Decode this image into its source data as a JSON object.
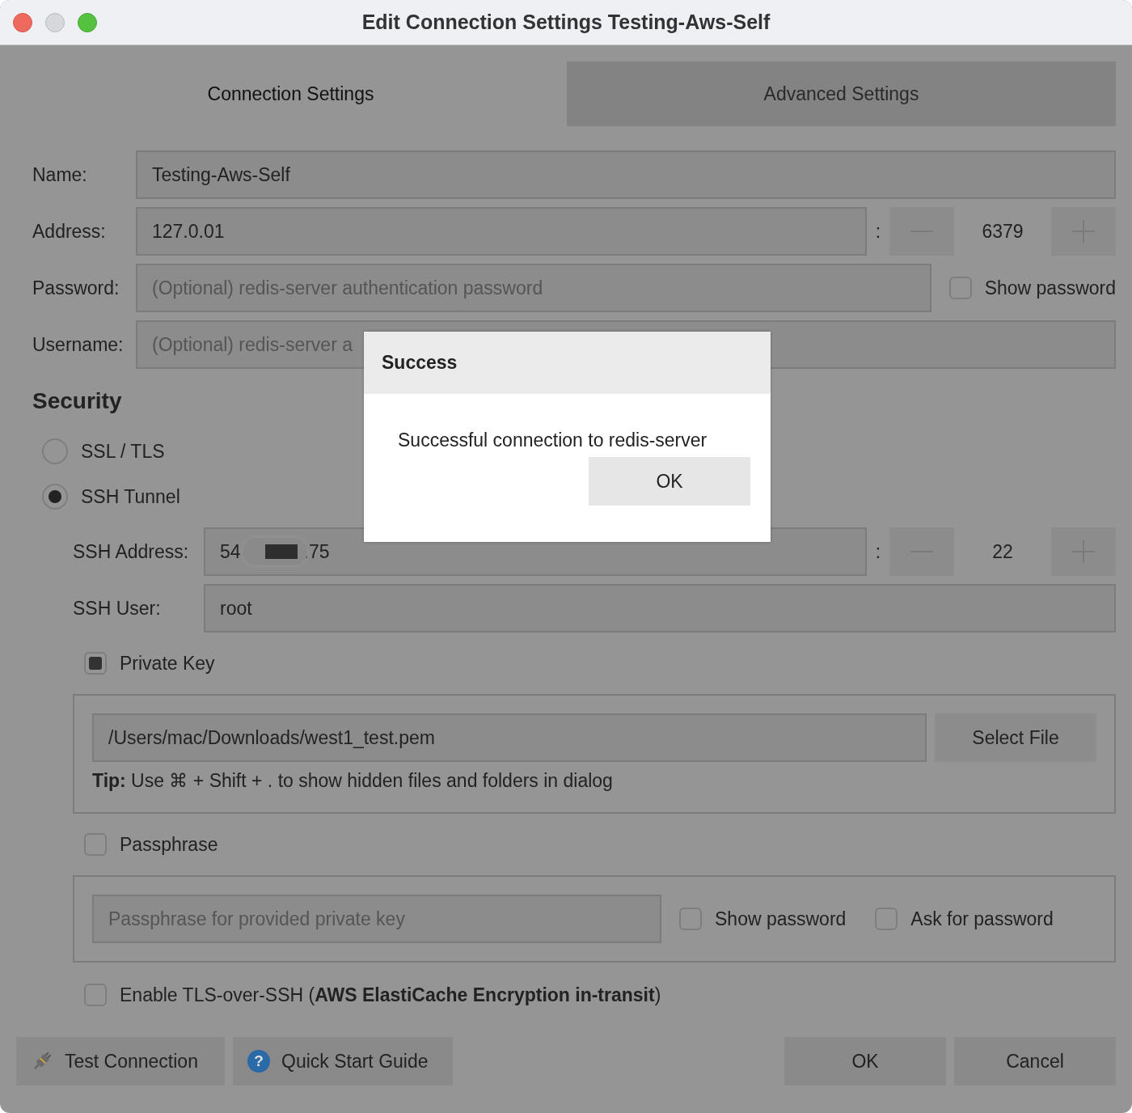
{
  "window": {
    "title": "Edit Connection Settings Testing-Aws-Self"
  },
  "tabs": [
    {
      "label": "Connection Settings",
      "selected": true
    },
    {
      "label": "Advanced Settings",
      "selected": false
    }
  ],
  "form": {
    "name": {
      "label": "Name:",
      "value": "Testing-Aws-Self"
    },
    "address": {
      "label": "Address:",
      "value": "127.0.01",
      "separator": ":",
      "port": "6379"
    },
    "password": {
      "label": "Password:",
      "placeholder": "(Optional) redis-server authentication password",
      "show_password": {
        "label": "Show password",
        "checked": false
      }
    },
    "username": {
      "label": "Username:",
      "placeholder": "(Optional) redis-server a"
    }
  },
  "security": {
    "heading": "Security",
    "options": [
      {
        "label": "SSL / TLS",
        "selected": false
      },
      {
        "label": "SSH Tunnel",
        "selected": true
      }
    ]
  },
  "ssh": {
    "address": {
      "label": "SSH Address:",
      "value_start": "54",
      "value_end": ".75",
      "separator": ":",
      "port": "22"
    },
    "user": {
      "label": "SSH User:",
      "value": "root"
    },
    "private_key": {
      "label": "Private Key",
      "checked": true,
      "path": "/Users/mac/Downloads/west1_test.pem",
      "button": "Select File",
      "tip": "**Tip:** Use ⌘ + Shift + . to show hidden files and folders in dialog"
    },
    "passphrase": {
      "label": "Passphrase",
      "checked": false,
      "placeholder": "Passphrase for provided private key",
      "show_password": {
        "label": "Show password",
        "checked": false
      },
      "ask_for_password": {
        "label": "Ask for password",
        "checked": false
      }
    },
    "tls": {
      "label": "Enable TLS-over-SSH (**AWS ElastiCache Encryption in-transit**)",
      "checked": false
    }
  },
  "buttons": {
    "test_connection": "Test Connection",
    "quick_start_guide": {
      "icon": "?",
      "label": "Quick Start Guide"
    },
    "ok": "OK",
    "cancel": "Cancel"
  },
  "dialog": {
    "title": "Success",
    "message": "Successful connection to redis-server",
    "button": "OK"
  }
}
